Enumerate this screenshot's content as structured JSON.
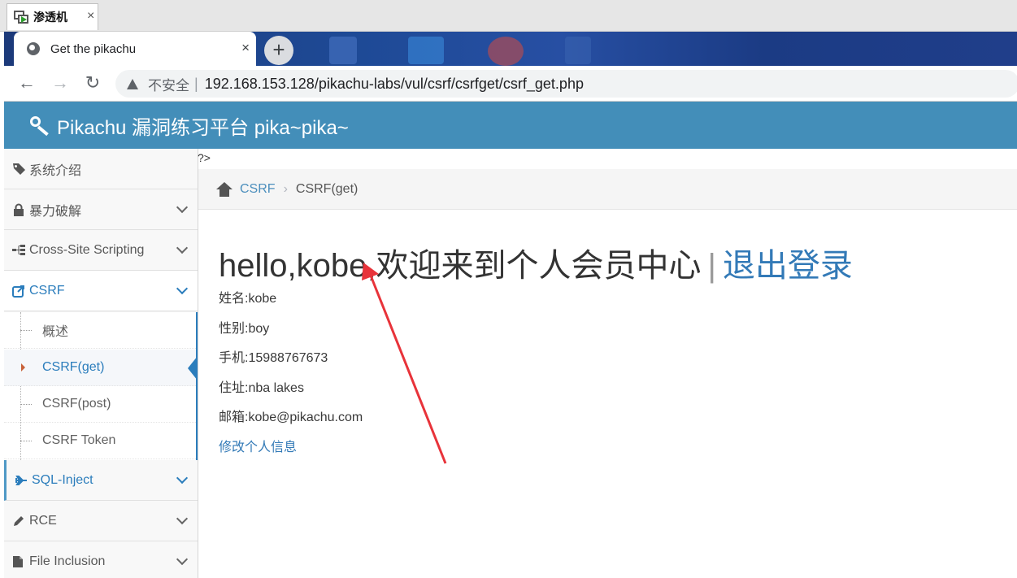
{
  "vm": {
    "tab_label": "渗透机",
    "close": "×"
  },
  "browser": {
    "tab_title": "Get the pikachu",
    "tab_close": "×",
    "new_tab": "+",
    "back": "←",
    "forward": "→",
    "reload": "↻",
    "security_label": "不安全",
    "separator": "|",
    "url": "192.168.153.128/pikachu-labs/vul/csrf/csrfget/csrf_get.php"
  },
  "header": {
    "title": "Pikachu 漏洞练习平台 pika~pika~"
  },
  "sidebar": {
    "items": [
      {
        "label": "系统介绍",
        "icon": "tags-icon"
      },
      {
        "label": "暴力破解",
        "icon": "lock-icon"
      },
      {
        "label": "Cross-Site Scripting",
        "icon": "sitemap-icon"
      },
      {
        "label": "CSRF",
        "icon": "share-icon"
      },
      {
        "label": "SQL-Inject",
        "icon": "plane-icon"
      },
      {
        "label": "RCE",
        "icon": "pencil-icon"
      },
      {
        "label": "File Inclusion",
        "icon": "file-icon"
      }
    ],
    "csrf_sub": [
      {
        "label": "概述"
      },
      {
        "label": "CSRF(get)"
      },
      {
        "label": "CSRF(post)"
      },
      {
        "label": "CSRF Token"
      }
    ]
  },
  "main": {
    "stray_text": "?>",
    "breadcrumb": {
      "section": "CSRF",
      "current": "CSRF(get)",
      "sep": "›"
    },
    "greeting": "hello,kobe,欢迎来到个人会员中心",
    "greeting_sep": "|",
    "logout": "退出登录",
    "profile": [
      "姓名:kobe",
      "性别:boy",
      "手机:15988767673",
      "住址:nba lakes",
      "邮箱:kobe@pikachu.com"
    ],
    "edit_link": "修改个人信息"
  },
  "colors": {
    "header_bg": "#438eb9",
    "link": "#337ab7",
    "annotation_arrow": "#e8333a"
  }
}
